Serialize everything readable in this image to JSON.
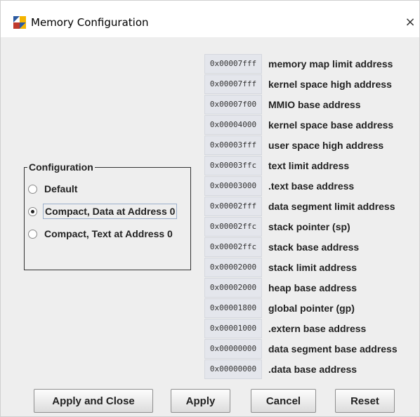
{
  "window": {
    "title": "Memory Configuration",
    "close_glyph": "×"
  },
  "configuration": {
    "legend": "Configuration",
    "options": [
      {
        "label": "Default",
        "selected": false
      },
      {
        "label": "Compact, Data at Address 0",
        "selected": true
      },
      {
        "label": "Compact, Text at Address 0",
        "selected": false
      }
    ]
  },
  "memory_map": [
    {
      "address": "0x00007fff",
      "label": "memory map limit address"
    },
    {
      "address": "0x00007fff",
      "label": "kernel space high address"
    },
    {
      "address": "0x00007f00",
      "label": "MMIO base address"
    },
    {
      "address": "0x00004000",
      "label": "kernel space base address"
    },
    {
      "address": "0x00003fff",
      "label": "user space high address"
    },
    {
      "address": "0x00003ffc",
      "label": "text limit address"
    },
    {
      "address": "0x00003000",
      "label": ".text base address"
    },
    {
      "address": "0x00002fff",
      "label": "data segment limit address"
    },
    {
      "address": "0x00002ffc",
      "label": "stack pointer (sp)"
    },
    {
      "address": "0x00002ffc",
      "label": "stack base address"
    },
    {
      "address": "0x00002000",
      "label": "stack limit address"
    },
    {
      "address": "0x00002000",
      "label": "heap base address"
    },
    {
      "address": "0x00001800",
      "label": "global pointer (gp)"
    },
    {
      "address": "0x00001000",
      "label": ".extern base address"
    },
    {
      "address": "0x00000000",
      "label": "data segment base address"
    },
    {
      "address": "0x00000000",
      "label": ".data base address"
    }
  ],
  "buttons": {
    "apply_and_close": "Apply and Close",
    "apply": "Apply",
    "cancel": "Cancel",
    "reset": "Reset"
  }
}
